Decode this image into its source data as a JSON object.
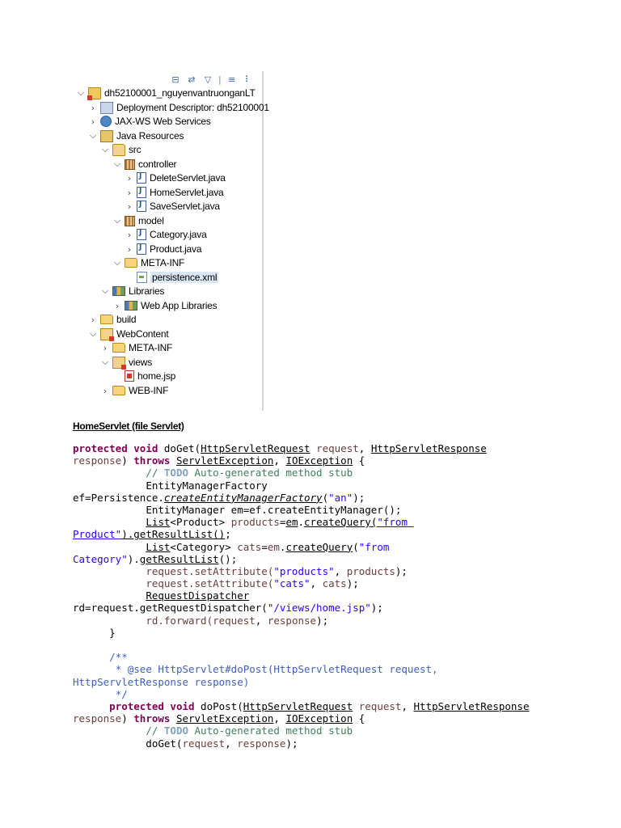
{
  "explorer": {
    "toolbar_icons": [
      "collapse-all-icon",
      "link-editor-icon",
      "filter-icon",
      "view-menu-icon",
      "minimize-icon"
    ],
    "tree": [
      {
        "label": "dh52100001_nguyenvantruonganLT",
        "icon": "web-project-icon",
        "expanded": true
      },
      {
        "label": "Deployment Descriptor: dh52100001",
        "icon": "deployment-descriptor-icon",
        "expanded": false
      },
      {
        "label": "JAX-WS Web Services",
        "icon": "web-services-icon",
        "expanded": false
      },
      {
        "label": "Java Resources",
        "icon": "java-resources-icon",
        "expanded": true
      },
      {
        "label": "src",
        "icon": "source-folder-icon",
        "expanded": true
      },
      {
        "label": "controller",
        "icon": "package-icon",
        "expanded": true
      },
      {
        "label": "DeleteServlet.java",
        "icon": "java-file-icon",
        "expanded": false
      },
      {
        "label": "HomeServlet.java",
        "icon": "java-file-icon",
        "expanded": false
      },
      {
        "label": "SaveServlet.java",
        "icon": "java-file-icon",
        "expanded": false
      },
      {
        "label": "model",
        "icon": "package-icon",
        "expanded": true
      },
      {
        "label": "Category.java",
        "icon": "java-file-icon",
        "expanded": false
      },
      {
        "label": "Product.java",
        "icon": "java-file-icon",
        "expanded": false
      },
      {
        "label": "META-INF",
        "icon": "folder-icon",
        "expanded": true
      },
      {
        "label": "persistence.xml",
        "icon": "xml-file-icon",
        "expanded": null
      },
      {
        "label": "Libraries",
        "icon": "libraries-icon",
        "expanded": true
      },
      {
        "label": "Web App Libraries",
        "icon": "libraries-icon",
        "expanded": false
      },
      {
        "label": "build",
        "icon": "folder-icon",
        "expanded": false
      },
      {
        "label": "WebContent",
        "icon": "web-content-icon",
        "expanded": true
      },
      {
        "label": "META-INF",
        "icon": "folder-icon",
        "expanded": false
      },
      {
        "label": "views",
        "icon": "web-folder-icon",
        "expanded": true
      },
      {
        "label": "home.jsp",
        "icon": "jsp-file-icon",
        "expanded": null
      },
      {
        "label": "WEB-INF",
        "icon": "folder-icon",
        "expanded": false
      }
    ]
  },
  "heading": "HomeServlet (file Servlet)",
  "code": {
    "protected": "protected",
    "void": "void",
    "throws": "throws",
    "doGet": " doGet(",
    "doPost": " doPost(",
    "HttpServletRequest": "HttpServletRequest",
    "HttpServletResponse": "HttpServletResponse",
    "ServletException": "ServletException",
    "IOException": "IOException",
    "request": "request",
    "response": "response",
    "todo_prefix": "// ",
    "todo": "TODO",
    "todo_text": " Auto-generated method stub",
    "emf_type": "EntityManagerFactory",
    "ef_assign": "ef=Persistence.",
    "createEMF": "createEntityManagerFactory",
    "an": "\"an\"",
    "em_type": "EntityManager ",
    "em_assign": "em=ef.createEntityManager();",
    "List": "List",
    "product_generic": "<Product> ",
    "products": "products",
    "em_eq": "=",
    "em": "em",
    "createQuery": "createQuery",
    "from_product_1": "\"from ",
    "from_product_2": "Product\"",
    "getResultList": "getResultList",
    "category_generic": "<Category> ",
    "cats": "cats",
    "from_category_1": "\"from",
    "from_category_2": "Category\"",
    "setAttribute": "request.setAttribute(",
    "str_products": "\"products\"",
    "str_cats": "\"cats\"",
    "RequestDispatcher": "RequestDispatcher",
    "rd_assign": "rd=request.getRequestDispatcher(",
    "views_path": "\"/views/home.jsp\"",
    "rd_forward": "rd.forward(",
    "close_brace": "}",
    "javadoc_open": "/**",
    "javadoc_see": "* @see HttpServlet#doPost(HttpServletRequest request,",
    "javadoc_see_2": "HttpServletResponse response)",
    "javadoc_close": "*/"
  }
}
